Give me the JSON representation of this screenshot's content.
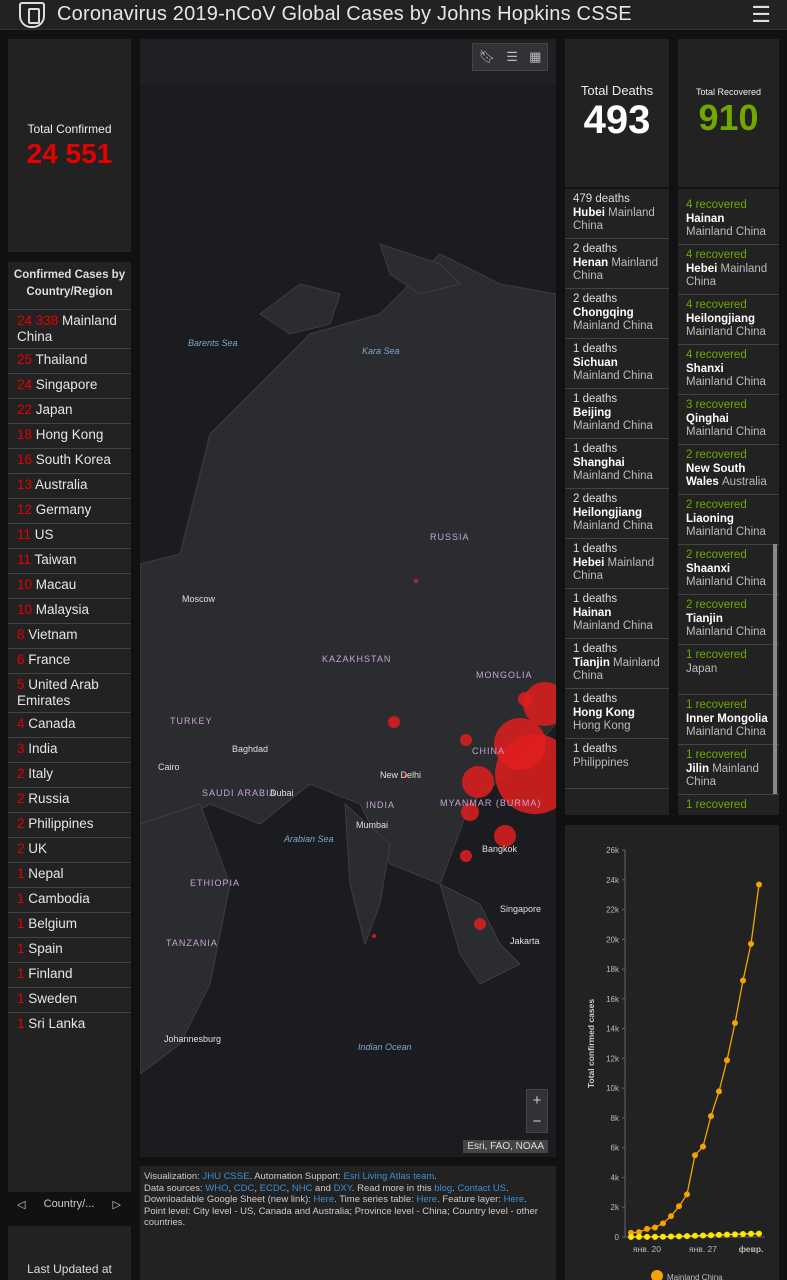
{
  "header": {
    "title": "Coronavirus 2019-nCoV Global Cases by Johns Hopkins CSSE"
  },
  "confirmed": {
    "label": "Total Confirmed",
    "value": "24 551"
  },
  "countries": {
    "title": "Confirmed Cases by Country/Region",
    "items": [
      {
        "n": "24 338",
        "name": "Mainland China"
      },
      {
        "n": "25",
        "name": "Thailand"
      },
      {
        "n": "24",
        "name": "Singapore"
      },
      {
        "n": "22",
        "name": "Japan"
      },
      {
        "n": "18",
        "name": "Hong Kong"
      },
      {
        "n": "16",
        "name": "South Korea"
      },
      {
        "n": "13",
        "name": "Australia"
      },
      {
        "n": "12",
        "name": "Germany"
      },
      {
        "n": "11",
        "name": "US"
      },
      {
        "n": "11",
        "name": "Taiwan"
      },
      {
        "n": "10",
        "name": "Macau"
      },
      {
        "n": "10",
        "name": "Malaysia"
      },
      {
        "n": "8",
        "name": "Vietnam"
      },
      {
        "n": "6",
        "name": "France"
      },
      {
        "n": "5",
        "name": "United Arab Emirates"
      },
      {
        "n": "4",
        "name": "Canada"
      },
      {
        "n": "3",
        "name": "India"
      },
      {
        "n": "2",
        "name": "Italy"
      },
      {
        "n": "2",
        "name": "Russia"
      },
      {
        "n": "2",
        "name": "Philippines"
      },
      {
        "n": "2",
        "name": "UK"
      },
      {
        "n": "1",
        "name": "Nepal"
      },
      {
        "n": "1",
        "name": "Cambodia"
      },
      {
        "n": "1",
        "name": "Belgium"
      },
      {
        "n": "1",
        "name": "Spain"
      },
      {
        "n": "1",
        "name": "Finland"
      },
      {
        "n": "1",
        "name": "Sweden"
      },
      {
        "n": "1",
        "name": "Sri Lanka"
      }
    ],
    "pager_label": "Country/..."
  },
  "last_updated": {
    "label": "Last Updated at"
  },
  "deaths": {
    "label": "Total Deaths",
    "value": "493",
    "items": [
      {
        "cnt": "479 deaths",
        "loc": "Hubei",
        "rest": "Mainland China"
      },
      {
        "cnt": "2 deaths",
        "loc": "Henan",
        "rest": "Mainland China"
      },
      {
        "cnt": "2 deaths",
        "loc": "Chongqing",
        "rest": "Mainland China"
      },
      {
        "cnt": "1 deaths",
        "loc": "Sichuan",
        "rest": "Mainland China"
      },
      {
        "cnt": "1 deaths",
        "loc": "Beijing",
        "rest": "Mainland China"
      },
      {
        "cnt": "1 deaths",
        "loc": "Shanghai",
        "rest": "Mainland China"
      },
      {
        "cnt": "2 deaths",
        "loc": "Heilongjiang",
        "rest": "Mainland China"
      },
      {
        "cnt": "1 deaths",
        "loc": "Hebei",
        "rest": "Mainland China"
      },
      {
        "cnt": "1 deaths",
        "loc": "Hainan",
        "rest": "Mainland China"
      },
      {
        "cnt": "1 deaths",
        "loc": "Tianjin",
        "rest": "Mainland China"
      },
      {
        "cnt": "1 deaths",
        "loc": "Hong Kong",
        "rest": "Hong Kong"
      },
      {
        "cnt": "1 deaths",
        "loc": "",
        "rest": "Philippines"
      }
    ]
  },
  "recovered": {
    "label": "Total Recovered",
    "value": "910",
    "items": [
      {
        "cnt": "4 recovered",
        "loc": "Hainan",
        "rest": "Mainland China"
      },
      {
        "cnt": "4 recovered",
        "loc": "Hebei",
        "rest": "Mainland China"
      },
      {
        "cnt": "4 recovered",
        "loc": "Heilongjiang",
        "rest": "Mainland China"
      },
      {
        "cnt": "4 recovered",
        "loc": "Shanxi",
        "rest": "Mainland China"
      },
      {
        "cnt": "3 recovered",
        "loc": "Qinghai",
        "rest": "Mainland China"
      },
      {
        "cnt": "2 recovered",
        "loc": "New South Wales",
        "rest": "Australia"
      },
      {
        "cnt": "2 recovered",
        "loc": "Liaoning",
        "rest": "Mainland China"
      },
      {
        "cnt": "2 recovered",
        "loc": "Shaanxi",
        "rest": "Mainland China"
      },
      {
        "cnt": "2 recovered",
        "loc": "Tianjin",
        "rest": "Mainland China"
      },
      {
        "cnt": "1 recovered",
        "loc": "",
        "rest": "Japan"
      },
      {
        "cnt": "1 recovered",
        "loc": "Inner Mongolia",
        "rest": "Mainland China"
      },
      {
        "cnt": "1 recovered",
        "loc": "Jilin",
        "rest": "Mainland China"
      },
      {
        "cnt": "1 recovered",
        "loc": "",
        "rest": ""
      }
    ]
  },
  "map": {
    "labels": [
      {
        "t": "Barents Sea",
        "k": "water"
      },
      {
        "t": "Kara Sea",
        "k": "water"
      },
      {
        "t": "RUSSIA",
        "k": "country"
      },
      {
        "t": "Moscow",
        "k": "city"
      },
      {
        "t": "KAZAKHSTAN",
        "k": "country"
      },
      {
        "t": "MONGOLIA",
        "k": "country"
      },
      {
        "t": "TURKEY",
        "k": "country"
      },
      {
        "t": "Baghdad",
        "k": "city"
      },
      {
        "t": "Cairo",
        "k": "city"
      },
      {
        "t": "SAUDI ARABIA",
        "k": "country"
      },
      {
        "t": "Dubai",
        "k": "city"
      },
      {
        "t": "New Delhi",
        "k": "city"
      },
      {
        "t": "INDIA",
        "k": "country"
      },
      {
        "t": "CHINA",
        "k": "country"
      },
      {
        "t": "MYANMAR (BURMA)",
        "k": "country"
      },
      {
        "t": "Mumbai",
        "k": "city"
      },
      {
        "t": "Arabian Sea",
        "k": "water"
      },
      {
        "t": "Bangkok",
        "k": "city"
      },
      {
        "t": "ETHIOPIA",
        "k": "country"
      },
      {
        "t": "Singapore",
        "k": "city"
      },
      {
        "t": "Jakarta",
        "k": "city"
      },
      {
        "t": "TANZANIA",
        "k": "country"
      },
      {
        "t": "Indian Ocean",
        "k": "water"
      },
      {
        "t": "Johannesburg",
        "k": "city"
      }
    ],
    "zoom_in": "+",
    "zoom_out": "−",
    "attribution": "Esri, FAO, NOAA"
  },
  "footer": {
    "p1": "Visualization: ",
    "jhu": "JHU CSSE",
    "p2": ". Automation Support: ",
    "esri": "Esri Living Atlas team",
    "p3": ".",
    "p4": "Data sources: ",
    "who": "WHO",
    "cdc": "CDC",
    "ecdc": "ECDC",
    "nhc": "NHC",
    "dxy": "DXY",
    "p5": ". Read more in this ",
    "blog": "blog",
    "contact": "Contact US",
    "p6": "Downloadable Google Sheet (new link): ",
    "here1": "Here",
    "p7": ". Time series table: ",
    "here2": "Here",
    "p8": ". Feature layer: ",
    "here3": "Here",
    "p9": ".",
    "p10": "Point level: City level - US, Canada and Australia; Province level - China; Country level - other countries."
  },
  "chart_data": {
    "type": "line",
    "ylabel": "Total confirmed cases",
    "yticks": [
      "0",
      "2k",
      "4k",
      "6k",
      "8k",
      "10k",
      "12k",
      "14k",
      "16k",
      "18k",
      "20k",
      "22k",
      "24k",
      "26k"
    ],
    "ylim": [
      0,
      26000
    ],
    "xticks": [
      {
        "label": "янв. 20",
        "i": 2
      },
      {
        "label": "янв. 27",
        "i": 9
      },
      {
        "label": "февр.",
        "i": 15
      }
    ],
    "legend": "Mainland China",
    "series": [
      {
        "name": "Mainland China",
        "color": "#f4a300",
        "values": [
          278,
          326,
          547,
          639,
          916,
          1399,
          2062,
          2863,
          5494,
          6070,
          8124,
          9783,
          11871,
          14380,
          17236,
          19693,
          23680
        ]
      },
      {
        "name": "",
        "color": "#ffe600",
        "values": [
          4,
          6,
          8,
          10,
          20,
          30,
          45,
          60,
          80,
          100,
          120,
          140,
          160,
          180,
          200,
          215,
          227
        ]
      }
    ]
  }
}
